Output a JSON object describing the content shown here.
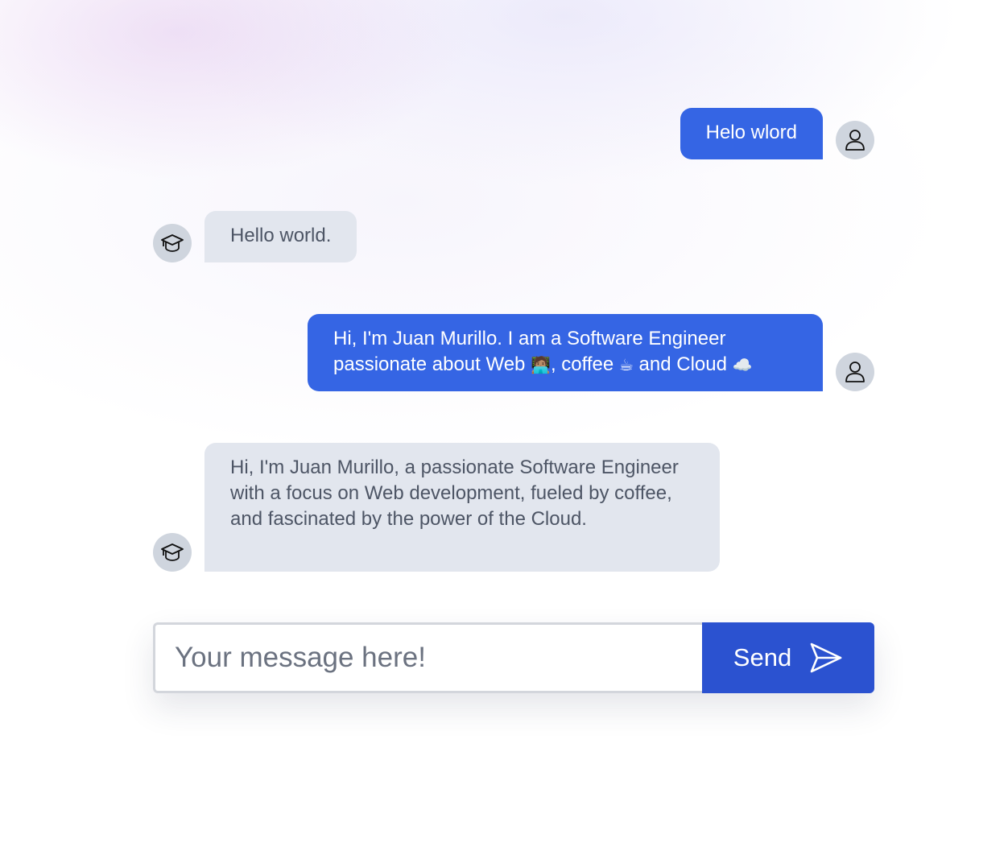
{
  "messages": [
    {
      "role": "user",
      "text": "Helo wlord"
    },
    {
      "role": "assistant",
      "text": "Hello world."
    },
    {
      "role": "user",
      "line1": "Hi, I'm Juan Murillo. I am a Software Engineer",
      "line2_a": "passionate about Web ",
      "emoji_web": "🧑🏽‍💻",
      "line2_b": ", coffee ",
      "emoji_coffee": "☕",
      "line2_c": " and Cloud ",
      "emoji_cloud": "☁️"
    },
    {
      "role": "assistant",
      "text": "Hi, I'm Juan Murillo, a passionate Software Engineer with a focus on Web development, fueled by coffee, and fascinated by the power of the Cloud."
    }
  ],
  "composer": {
    "placeholder": "Your message here!",
    "send_label": "Send"
  },
  "icons": {
    "user_avatar": "user-icon",
    "assistant_avatar": "graduation-cap-icon",
    "send": "paper-plane-icon"
  },
  "colors": {
    "user_bubble": "#3565e4",
    "assistant_bubble": "#e2e6ee",
    "send_button": "#2b52d0",
    "avatar_bg": "#cfd5de"
  }
}
